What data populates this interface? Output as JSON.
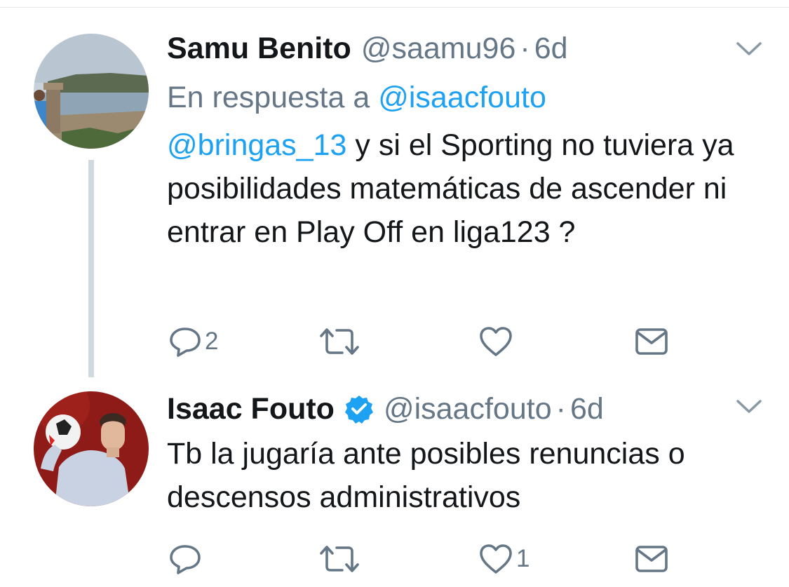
{
  "tweets": [
    {
      "author_name": "Samu Benito",
      "handle": "@saamu96",
      "separator": "·",
      "time": "6d",
      "reply_prefix": "En respuesta a",
      "reply_handle": "@isaacfouto",
      "mention": "@bringas_13",
      "text": " y si el Sporting no tuviera ya posibilidades matemáticas de ascender ni entrar en Play Off en liga123 ?",
      "verified": false,
      "reply_count": "2",
      "retweet_count": "",
      "like_count": ""
    },
    {
      "author_name": "Isaac Fouto",
      "handle": "@isaacfouto",
      "separator": "·",
      "time": "6d",
      "text": "Tb la jugaría ante posibles renuncias o descensos administrativos",
      "verified": true,
      "reply_count": "",
      "retweet_count": "",
      "like_count": "1"
    }
  ],
  "icons": {
    "reply": "reply-icon",
    "retweet": "retweet-icon",
    "like": "heart-icon",
    "dm": "envelope-icon",
    "more": "chevron-down-icon",
    "verified": "verified-badge-icon"
  },
  "colors": {
    "text": "#14171a",
    "muted": "#657786",
    "link": "#1da1f2",
    "thread_line": "#cfd9de",
    "icon": "#657786"
  }
}
